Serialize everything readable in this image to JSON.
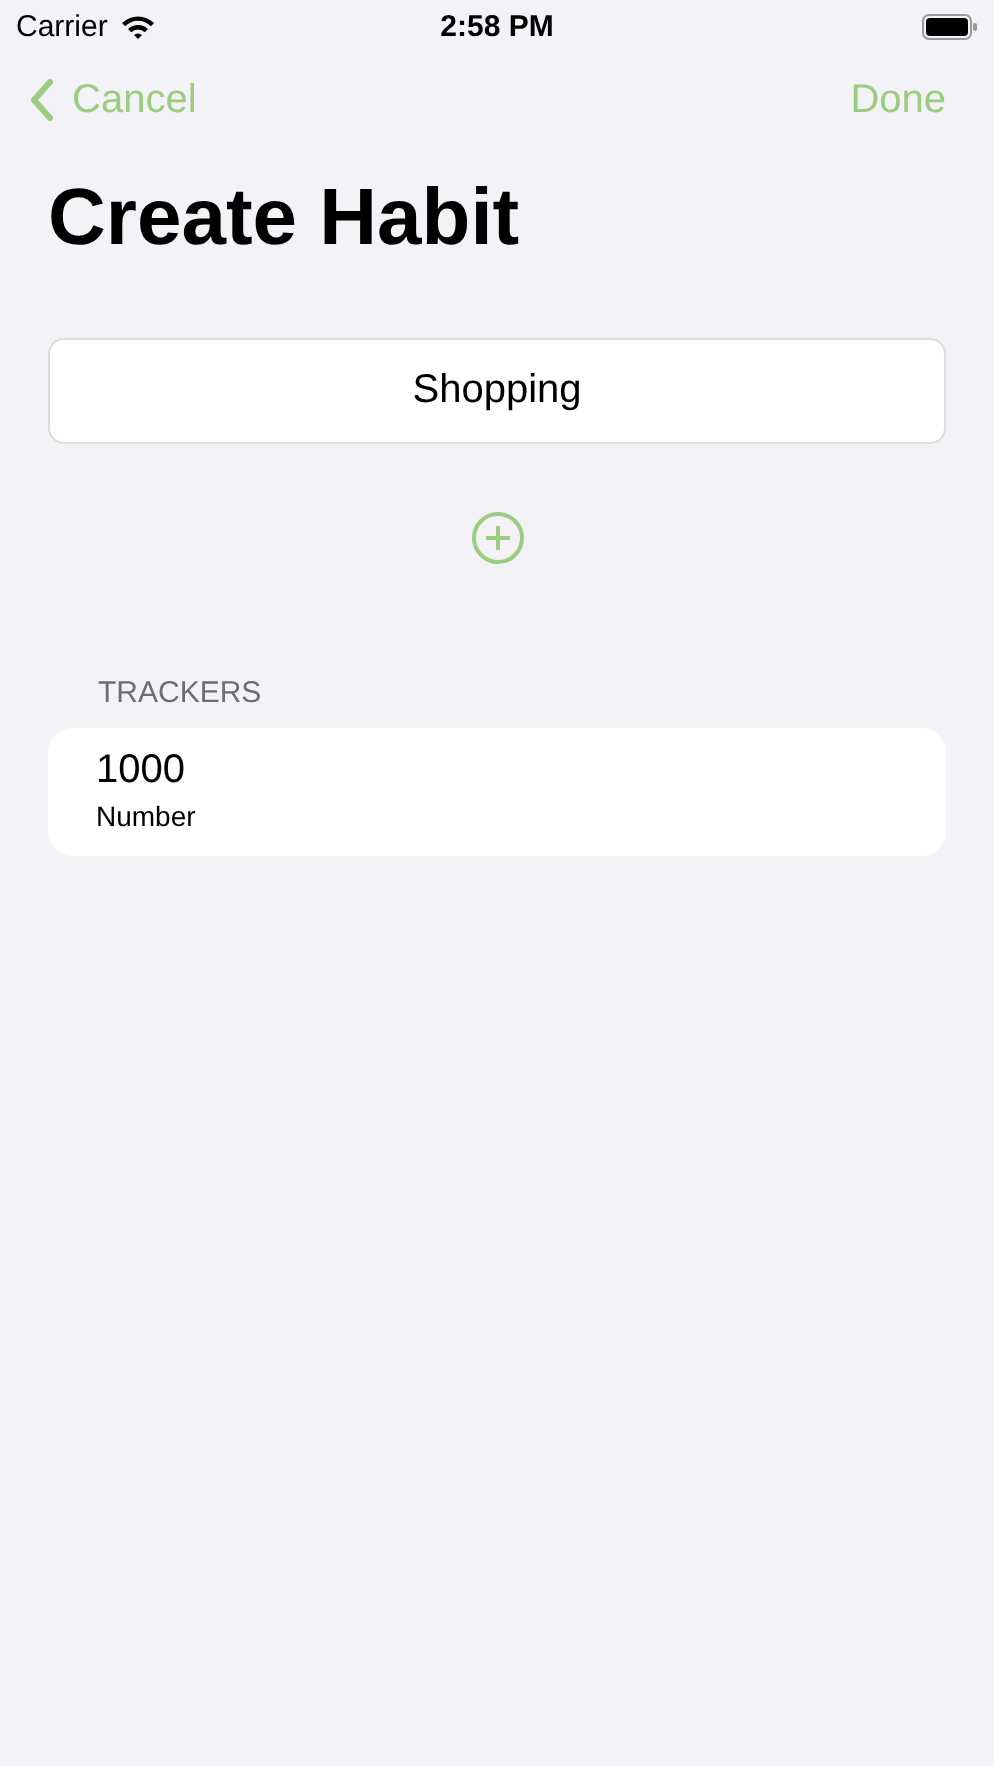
{
  "status_bar": {
    "carrier": "Carrier",
    "time": "2:58 PM"
  },
  "nav": {
    "back": "Cancel",
    "done": "Done"
  },
  "title": "Create Habit",
  "name_field": {
    "value": "Shopping"
  },
  "trackers": {
    "header": "TRACKERS",
    "items": [
      {
        "value": "1000",
        "type": "Number"
      }
    ]
  }
}
